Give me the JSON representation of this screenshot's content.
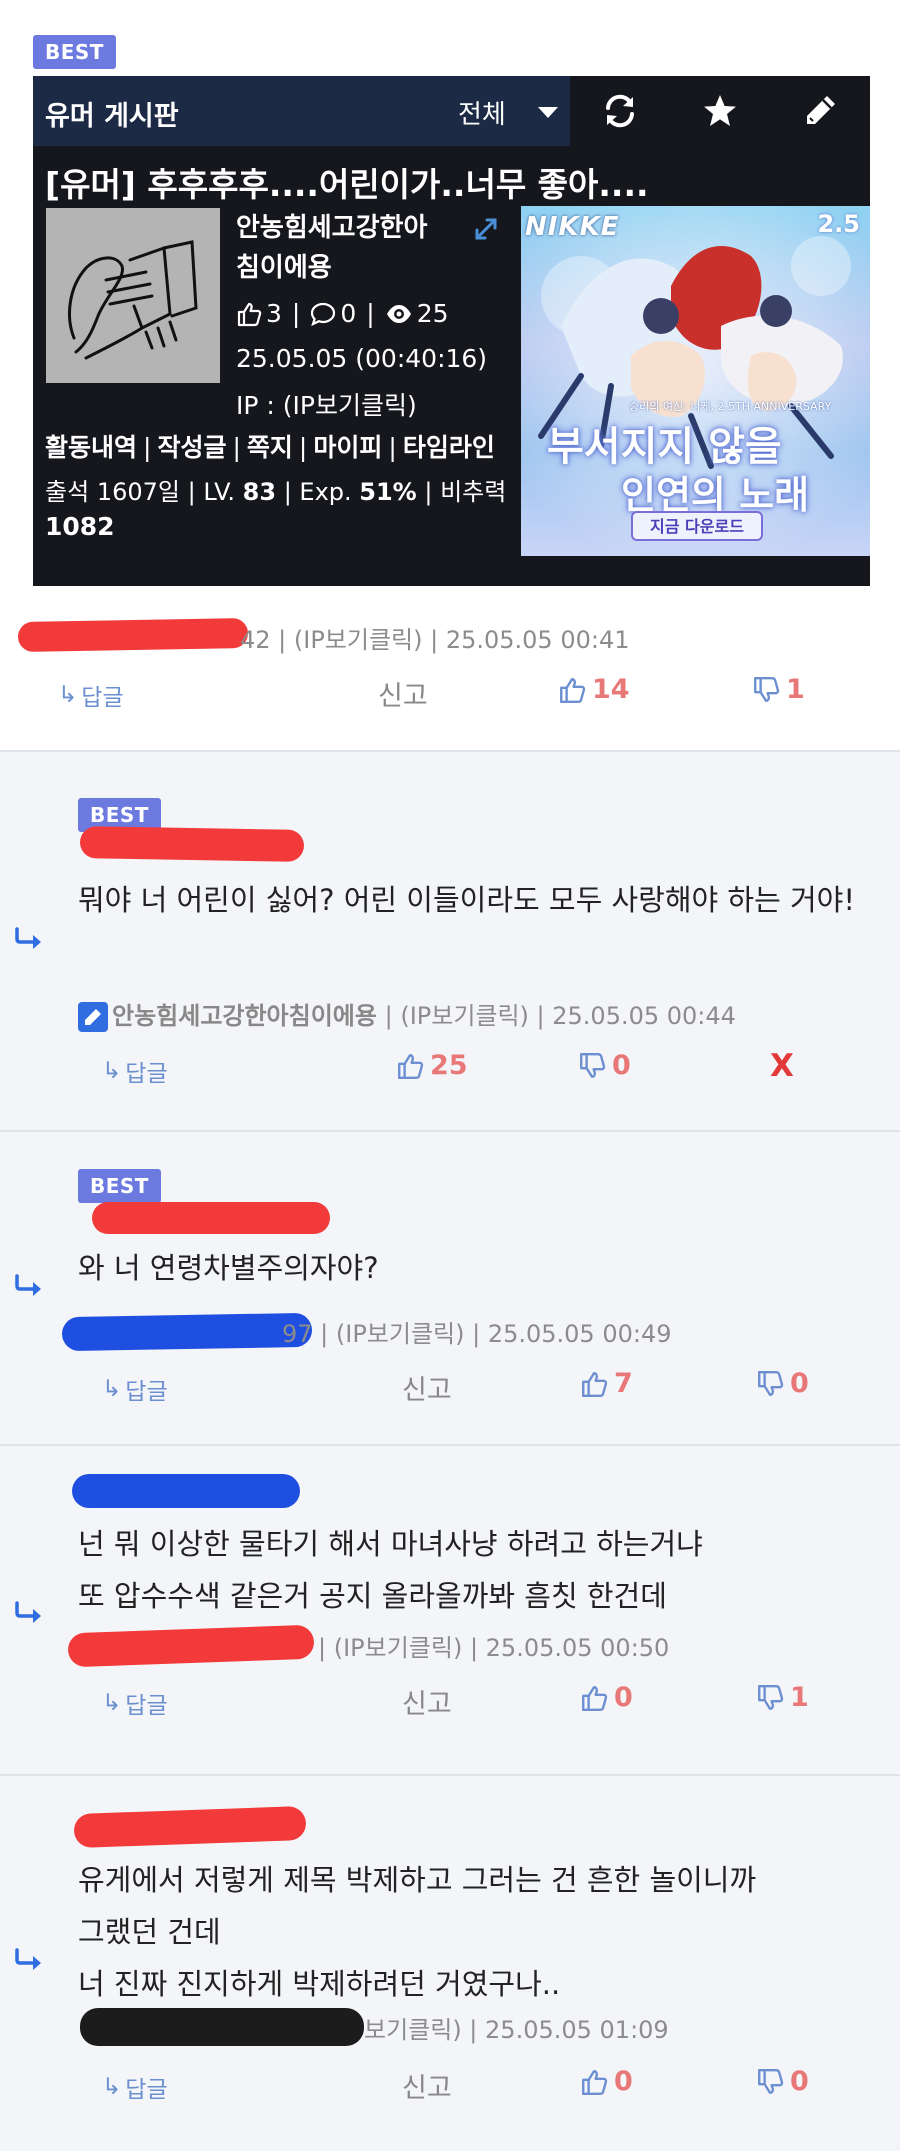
{
  "top_badge": "BEST",
  "board": {
    "name": "유머 게시판",
    "filter": "전체"
  },
  "post": {
    "title": "[유머] 후후후후....어린이가..너무 좋아....",
    "author_name": "안농힘세고강한아침이에용",
    "likes": "3",
    "comments": "0",
    "views": "25",
    "date": "25.05.05 (00:40:16)",
    "ip": "IP : (IP보기클릭)"
  },
  "ad": {
    "brand": "NIKKE",
    "badge": "2.5",
    "subtitle": "승리의 여신: 니케, 2.5TH ANNIVERSARY",
    "headline1": "부서지지 않을",
    "headline2": "인연의 노래",
    "cta": "지금 다운로드"
  },
  "profile": {
    "links": [
      "활동내역",
      "작성글",
      "쪽지",
      "마이피",
      "타임라인"
    ],
    "attendance_label": "출석",
    "attendance": "1607일",
    "level_label": "LV.",
    "level": "83",
    "exp_label": "Exp.",
    "exp": "51%",
    "ratio_label": "비추력",
    "ratio": "1082"
  },
  "comments": [
    {
      "meta_tail": "42 | (IP보기클릭) | 25.05.05 00:41",
      "reply": "답글",
      "report": "신고",
      "up": "14",
      "down": "1"
    },
    {
      "badge": "BEST",
      "text": "뭐야 너 어린이 싫어? 어린 이들이라도 모두 사랑해야 하는 거야!",
      "author": "안농힘세고강한아침이에용",
      "meta_tail": "| (IP보기클릭) | 25.05.05 00:44",
      "reply": "답글",
      "up": "25",
      "down": "0",
      "delete": "X"
    },
    {
      "badge": "BEST",
      "text": "와 너 연령차별주의자야?",
      "meta_tail": "97 | (IP보기클릭) | 25.05.05 00:49",
      "reply": "답글",
      "report": "신고",
      "up": "7",
      "down": "0"
    },
    {
      "text": "넌 뭐 이상한 물타기 해서 마녀사냥 하려고 하는거냐\n또 압수수색 같은거 공지 올라올까봐 흠칫 한건데",
      "meta_tail": "| (IP보기클릭) | 25.05.05 00:50",
      "reply": "답글",
      "report": "신고",
      "up": "0",
      "down": "1"
    },
    {
      "text": "유게에서 저렇게 제목 박제하고 그러는 건 흔한 놀이니까\n그랬던 건데\n너 진짜 진지하게 박제하려던 거였구나..",
      "meta_tail": "보기클릭) | 25.05.05 01:09",
      "reply": "답글",
      "report": "신고",
      "up": "0",
      "down": "0"
    }
  ],
  "colors": {
    "accent_best": "#6c7ae0",
    "board_bar": "#1c2a45",
    "redact_red": "#f33a3a",
    "redact_blue": "#1f4fe0",
    "redact_black": "#1c1c1c",
    "reply_blue": "#6b8fd0",
    "vote_red": "#e87878"
  }
}
